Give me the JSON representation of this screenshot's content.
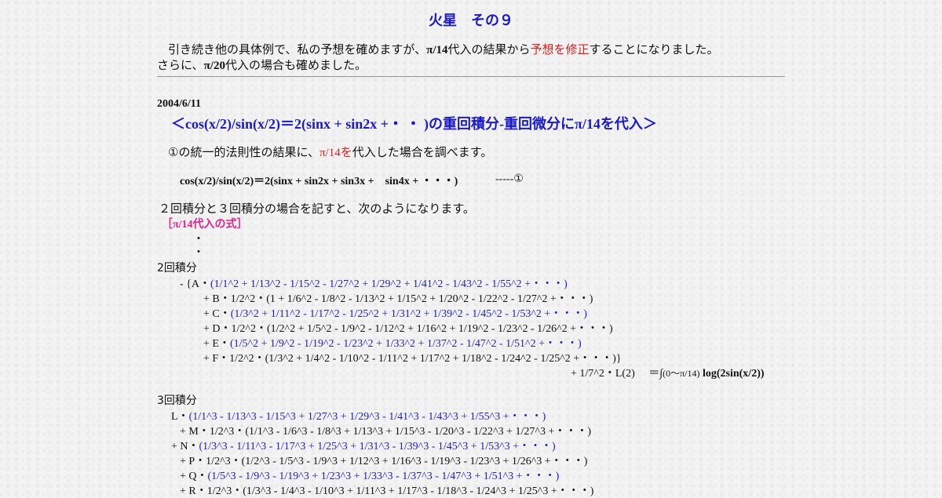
{
  "title": "火星　その９",
  "intro": {
    "line1_a": "引き続き他の具体例で、私の予想を確めますが、",
    "line1_b": "π/14",
    "line1_c": "代入の結果から",
    "line1_d": "予想を修正",
    "line1_e": "することになりました。",
    "line2_a": "さらに、",
    "line2_b": "π/20",
    "line2_c": "代入の場合も確めました。"
  },
  "section": {
    "date": "2004/6/11",
    "heading": "＜cos(x/2)/sin(x/2)＝2(sinx + sin2x +・ ・ )の重回積分-重回微分にπ/14を代入＞",
    "desc_a": "①の統一的法則性の結果に、",
    "desc_b": "π/14を",
    "desc_c": "代入した場合を調べます。",
    "equation": "cos(x/2)/sin(x/2)＝2(sinx + sin2x + sin3x +　sin4x + ・・・)",
    "equation_ref": "-----①",
    "para": "２回積分と３回積分の場合を記すと、次のようになります。",
    "formula_label": "［π/14代入の式］",
    "dot1": "・",
    "dot2": "・",
    "int2_label": "2回積分",
    "int2": [
      {
        "prefix": "-  {A・",
        "body": "(1/1^2 + 1/13^2 - 1/15^2 - 1/27^2 + 1/29^2 + 1/41^2 - 1/43^2 - 1/55^2 +・・・)",
        "blue": true
      },
      {
        "prefix": "+ B・1/2^2・",
        "body": "(1 + 1/6^2 - 1/8^2 - 1/13^2 + 1/15^2 + 1/20^2 - 1/22^2 - 1/27^2 +・・・)",
        "blue": false
      },
      {
        "prefix": "+ C・",
        "body": "(1/3^2 + 1/11^2 - 1/17^2 - 1/25^2 + 1/31^2 + 1/39^2 - 1/45^2 - 1/53^2 +・・・)",
        "blue": true
      },
      {
        "prefix": "+ D・1/2^2・",
        "body": "(1/2^2 + 1/5^2 - 1/9^2 - 1/12^2 + 1/16^2 + 1/19^2 - 1/23^2 - 1/26^2 +・・・)",
        "blue": false
      },
      {
        "prefix": "+ E・",
        "body": "(1/5^2 + 1/9^2 - 1/19^2 - 1/23^2 + 1/33^2 + 1/37^2 - 1/47^2 - 1/51^2 +・・・)",
        "blue": true
      },
      {
        "prefix": "+ F・1/2^2・",
        "body": "(1/3^2 + 1/4^2 - 1/10^2 - 1/11^2 + 1/17^2 + 1/18^2 - 1/24^2 - 1/25^2 +・・・)}",
        "blue": false
      }
    ],
    "int2_tail_a": "+ 1/7^2・L(2)",
    "int2_tail_b": "＝∫",
    "int2_tail_c": "(0～π/14)",
    "int2_tail_d": "log(2sin(x/2))",
    "int3_label": "3回積分",
    "int3": [
      {
        "prefix": "L・",
        "body": "(1/1^3 - 1/13^3 - 1/15^3 + 1/27^3 + 1/29^3 - 1/41^3 - 1/43^3 + 1/55^3 +・・・)",
        "blue": true
      },
      {
        "prefix": "+ M・1/2^3・",
        "body": "(1/1^3 - 1/6^3 - 1/8^3 + 1/13^3 + 1/15^3 - 1/20^3 - 1/22^3 + 1/27^3 +・・・)",
        "blue": false
      },
      {
        "prefix": "+ N・",
        "body": "(1/3^3 - 1/11^3 - 1/17^3 + 1/25^3 + 1/31^3 - 1/39^3 - 1/45^3 + 1/53^3 +・・・)",
        "blue": true
      },
      {
        "prefix": "+ P・1/2^3・",
        "body": "(1/2^3 - 1/5^3 - 1/9^3 + 1/12^3 + 1/16^3 - 1/19^3 - 1/23^3 + 1/26^3 +・・・)",
        "blue": false
      },
      {
        "prefix": "+ Q・",
        "body": "(1/5^3 - 1/9^3 - 1/19^3 + 1/23^3 + 1/33^3 - 1/37^3 - 1/47^3 + 1/51^3 +・・・)",
        "blue": true
      },
      {
        "prefix": "+ R・1/2^3・",
        "body": "(1/3^3 - 1/4^3 - 1/10^3 + 1/11^3 + 1/17^3 - 1/18^3 - 1/24^3 + 1/25^3 +・・・)",
        "blue": false
      }
    ]
  },
  "colors": {
    "title": "#1a1acc",
    "red": "#e02020",
    "series_blue": "#2020cc",
    "pink": "#e0248a"
  }
}
